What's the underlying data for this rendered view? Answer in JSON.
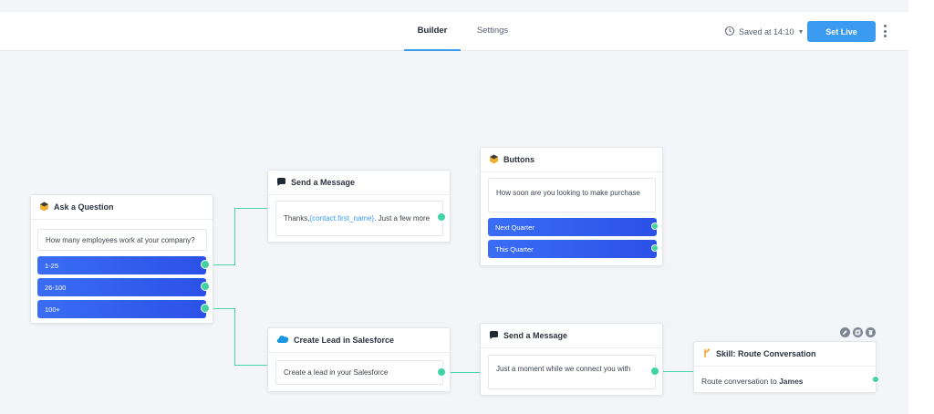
{
  "header": {
    "tabs": [
      {
        "label": "Builder",
        "active": true
      },
      {
        "label": "Settings",
        "active": false
      }
    ],
    "saved_label": "Saved at 14:10",
    "set_live_label": "Set Live"
  },
  "nodes": {
    "ask_question": {
      "title": "Ask a Question",
      "question": "How many employees work at your company?",
      "options": [
        "1-25",
        "26-100",
        "100+"
      ]
    },
    "send_message_1": {
      "title": "Send a Message",
      "text_prefix": "Thanks, ",
      "variable": "{contact.first_name}",
      "text_suffix": ". Just a few more"
    },
    "buttons": {
      "title": "Buttons",
      "question": "How soon are you looking to make purchase",
      "options": [
        "Next Quarter",
        "This Quarter"
      ]
    },
    "create_lead": {
      "title": "Create Lead in Salesforce",
      "text": "Create a lead in your Salesforce"
    },
    "send_message_2": {
      "title": "Send a Message",
      "text": "Just a moment while we connect you with"
    },
    "route": {
      "title": "Skill: Route Conversation",
      "text_prefix": "Route conversation to ",
      "agent": "James"
    }
  },
  "colors": {
    "accent": "#3a9bf0",
    "option_button": "#2f5bec",
    "connector": "#3ed3a2",
    "canvas": "#f3f5f8"
  }
}
